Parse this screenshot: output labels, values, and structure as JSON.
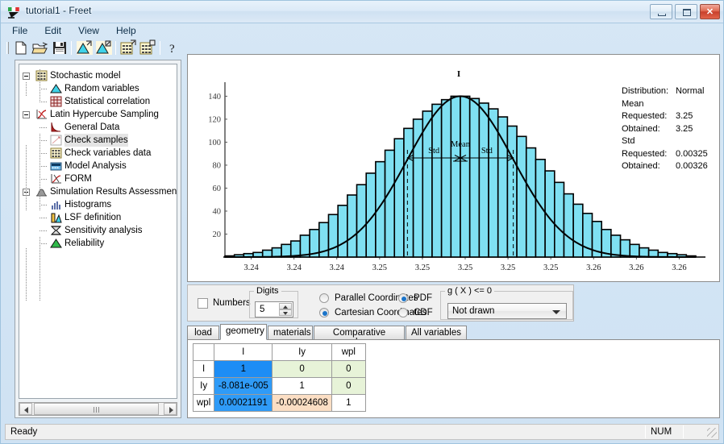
{
  "window": {
    "title": "tutorial1 - Freet",
    "app_icon": "freet-logo-icon",
    "minimize_label": "",
    "maximize_label": "",
    "close_label": "✕"
  },
  "menu": {
    "items": [
      {
        "label": "File",
        "name": "menu-file"
      },
      {
        "label": "Edit",
        "name": "menu-edit"
      },
      {
        "label": "View",
        "name": "menu-view"
      },
      {
        "label": "Help",
        "name": "menu-help"
      }
    ]
  },
  "toolbar": {
    "buttons": [
      {
        "name": "new-document-button",
        "icon": "new-document-icon"
      },
      {
        "name": "open-folder-button",
        "icon": "open-folder-icon"
      },
      {
        "name": "save-button",
        "icon": "floppy-disk-icon"
      },
      {
        "name": "random-variables-button",
        "icon": "distribution-curve-icon"
      },
      {
        "name": "statistical-correlation-button",
        "icon": "distribution-curve-alt-icon"
      },
      {
        "name": "variables-data-button",
        "icon": "grid-table-icon"
      },
      {
        "name": "variables-data-alt-button",
        "icon": "grid-table-alt-icon"
      },
      {
        "name": "help-button",
        "icon": "question-mark-icon"
      }
    ]
  },
  "tree": {
    "nodes": [
      {
        "label": "Stochastic model",
        "level": 0,
        "icon": "grid-yellow-icon",
        "expander": "minus",
        "selected": false
      },
      {
        "label": "Random variables",
        "level": 1,
        "icon": "blue-curve-icon",
        "expander": "none",
        "selected": false
      },
      {
        "label": "Statistical correlation",
        "level": 1,
        "icon": "red-grid-icon",
        "expander": "none",
        "selected": false
      },
      {
        "label": "Latin Hypercube Sampling",
        "level": 0,
        "icon": "red-chart-icon",
        "expander": "minus",
        "selected": false
      },
      {
        "label": "General Data",
        "level": 1,
        "icon": "red-decay-curve-icon",
        "expander": "none",
        "selected": false
      },
      {
        "label": "Check samples",
        "level": 1,
        "icon": "scatter-line-icon",
        "expander": "none",
        "selected": true
      },
      {
        "label": "Check variables data",
        "level": 1,
        "icon": "grid-yellow-icon",
        "expander": "none",
        "selected": false
      },
      {
        "label": "Model Analysis",
        "level": 1,
        "icon": "blue-panel-icon",
        "expander": "none",
        "selected": false
      },
      {
        "label": "FORM",
        "level": 1,
        "icon": "form-chart-icon",
        "expander": "none",
        "selected": false
      },
      {
        "label": "Simulation Results Assessment",
        "level": 0,
        "icon": "grey-hill-icon",
        "expander": "minus",
        "selected": false
      },
      {
        "label": "Histograms",
        "level": 1,
        "icon": "histogram-icon",
        "expander": "none",
        "selected": false
      },
      {
        "label": "LSF definition",
        "level": 1,
        "icon": "lsf-bars-icon",
        "expander": "none",
        "selected": false
      },
      {
        "label": "Sensitivity analysis",
        "level": 1,
        "icon": "hourglass-icon",
        "expander": "none",
        "selected": false
      },
      {
        "label": "Reliability",
        "level": 1,
        "icon": "green-hill-icon",
        "expander": "none",
        "selected": false
      }
    ],
    "scrollbar": {
      "left_arrow": "scroll-left-arrow-icon",
      "right_arrow": "scroll-right-arrow-icon"
    }
  },
  "chart_data": {
    "type": "bar",
    "title": "I",
    "xlabel": "",
    "ylabel": "",
    "grid": false,
    "legend": null,
    "x_tick_labels": [
      "3.24",
      "3.24",
      "3.24",
      "3.25",
      "3.25",
      "3.25",
      "3.25",
      "3.25",
      "3.26",
      "3.26",
      "3.26"
    ],
    "y_tick_labels": [
      "20",
      "40",
      "60",
      "80",
      "100",
      "120",
      "140"
    ],
    "ylim": [
      0,
      148
    ],
    "xlim": [
      3.2355,
      3.2645
    ],
    "annotations": [
      {
        "label": "Mean",
        "x": 3.25,
        "type": "center-marker"
      },
      {
        "label": "Std",
        "x_from": 3.24675,
        "x_to": 3.25,
        "type": "span-arrow"
      },
      {
        "label": "Std",
        "x_from": 3.25,
        "x_to": 3.25325,
        "type": "span-arrow"
      }
    ],
    "bar_color": "#7fe0f2",
    "bar_edge_color": "#000000",
    "curve_color": "#000000",
    "n_bins": 50,
    "values": [
      1,
      2,
      3,
      4,
      6,
      8,
      11,
      14,
      19,
      24,
      30,
      37,
      45,
      54,
      63,
      73,
      83,
      93,
      103,
      112,
      120,
      127,
      133,
      137,
      140,
      140,
      138,
      134,
      129,
      122,
      114,
      105,
      95,
      85,
      75,
      65,
      55,
      46,
      38,
      31,
      24,
      19,
      15,
      11,
      8,
      6,
      4,
      3,
      2,
      1
    ]
  },
  "chart_info": {
    "rows": [
      {
        "key": "Distribution:",
        "value": "Normal"
      },
      {
        "key": "Mean",
        "value": ""
      },
      {
        "key": "Requested:",
        "value": "3.25"
      },
      {
        "key": "Obtained:",
        "value": "3.25"
      },
      {
        "key": "Std",
        "value": ""
      },
      {
        "key": "Requested:",
        "value": "0.00325"
      },
      {
        "key": "Obtained:",
        "value": "0.00326"
      }
    ]
  },
  "controls": {
    "numbers_label": "Numbers",
    "numbers_checked": false,
    "digits_group_label": "Digits",
    "digits_value": "5",
    "coordinate_options": [
      {
        "label": "Parallel Coordinates",
        "selected": false
      },
      {
        "label": "Cartesian Coordinates",
        "selected": true
      }
    ],
    "function_options": [
      {
        "label": "PDF",
        "selected": true
      },
      {
        "label": "CDF",
        "selected": false
      }
    ],
    "gx_group_label": "g ( X ) <= 0",
    "gx_selected": "Not drawn"
  },
  "tabs": [
    {
      "label": "load",
      "active": false
    },
    {
      "label": "geometry",
      "active": true
    },
    {
      "label": "materials",
      "active": false
    },
    {
      "label": "Comparative values",
      "active": false
    },
    {
      "label": "All variables",
      "active": false
    }
  ],
  "table": {
    "corner": "",
    "columns": [
      "I",
      "Iy",
      "wpl"
    ],
    "rows": [
      {
        "header": "I",
        "cells": [
          {
            "value": "1",
            "style": "c-sel"
          },
          {
            "value": "0",
            "style": "c-green"
          },
          {
            "value": "0",
            "style": "c-green"
          }
        ]
      },
      {
        "header": "Iy",
        "cells": [
          {
            "value": "-8.081e-005",
            "style": "c-blue"
          },
          {
            "value": "1",
            "style": "c-white"
          },
          {
            "value": "0",
            "style": "c-green"
          }
        ]
      },
      {
        "header": "wpl",
        "cells": [
          {
            "value": "0.00021191",
            "style": "c-blue"
          },
          {
            "value": "-0.00024608",
            "style": "c-orange"
          },
          {
            "value": "1",
            "style": "c-white"
          }
        ]
      }
    ]
  },
  "statusbar": {
    "message": "Ready",
    "num_indicator": "NUM"
  }
}
